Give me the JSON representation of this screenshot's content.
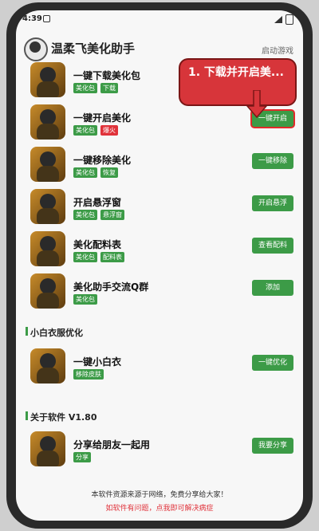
{
  "status_bar": {
    "time": "4:39"
  },
  "header": {
    "title": "温柔飞美化助手",
    "action": "启动游戏"
  },
  "items": [
    {
      "title": "一键下载美化包",
      "tags": [
        {
          "text": "美化包",
          "color": "green"
        },
        {
          "text": "下载",
          "color": "green"
        }
      ]
    },
    {
      "title": "一键开启美化",
      "tags": [
        {
          "text": "美化包",
          "color": "green"
        },
        {
          "text": "爆火",
          "color": "red"
        }
      ],
      "button": "一键开启"
    },
    {
      "title": "一键移除美化",
      "tags": [
        {
          "text": "美化包",
          "color": "green"
        },
        {
          "text": "恢复",
          "color": "green"
        }
      ],
      "button": "一键移除"
    },
    {
      "title": "开启悬浮窗",
      "tags": [
        {
          "text": "美化包",
          "color": "green"
        },
        {
          "text": "悬浮窗",
          "color": "green"
        }
      ],
      "button": "开启悬浮"
    },
    {
      "title": "美化配料表",
      "tags": [
        {
          "text": "美化包",
          "color": "green"
        },
        {
          "text": "配料表",
          "color": "green"
        }
      ],
      "button": "查看配料"
    },
    {
      "title": "美化助手交流Q群",
      "tags": [
        {
          "text": "美化包",
          "color": "green"
        }
      ],
      "button": "添加"
    }
  ],
  "section1": {
    "title": "小白衣服优化",
    "item": {
      "title": "一键小白衣",
      "tags": [
        {
          "text": "移除皮肤",
          "color": "green"
        }
      ],
      "button": "一键优化"
    }
  },
  "section2": {
    "title": "关于软件 V1.80",
    "item": {
      "title": "分享给朋友一起用",
      "tags": [
        {
          "text": "分享",
          "color": "green"
        }
      ],
      "button": "我要分享"
    }
  },
  "footer": {
    "line1": "本软件资源来源于网络，免费分享给大家！",
    "line2": "如软件有问题，点我即可解决病症"
  },
  "callout": {
    "text": "1. 下载并开启美..."
  },
  "colors": {
    "accent": "#3c9b47",
    "red": "#e0323a"
  }
}
